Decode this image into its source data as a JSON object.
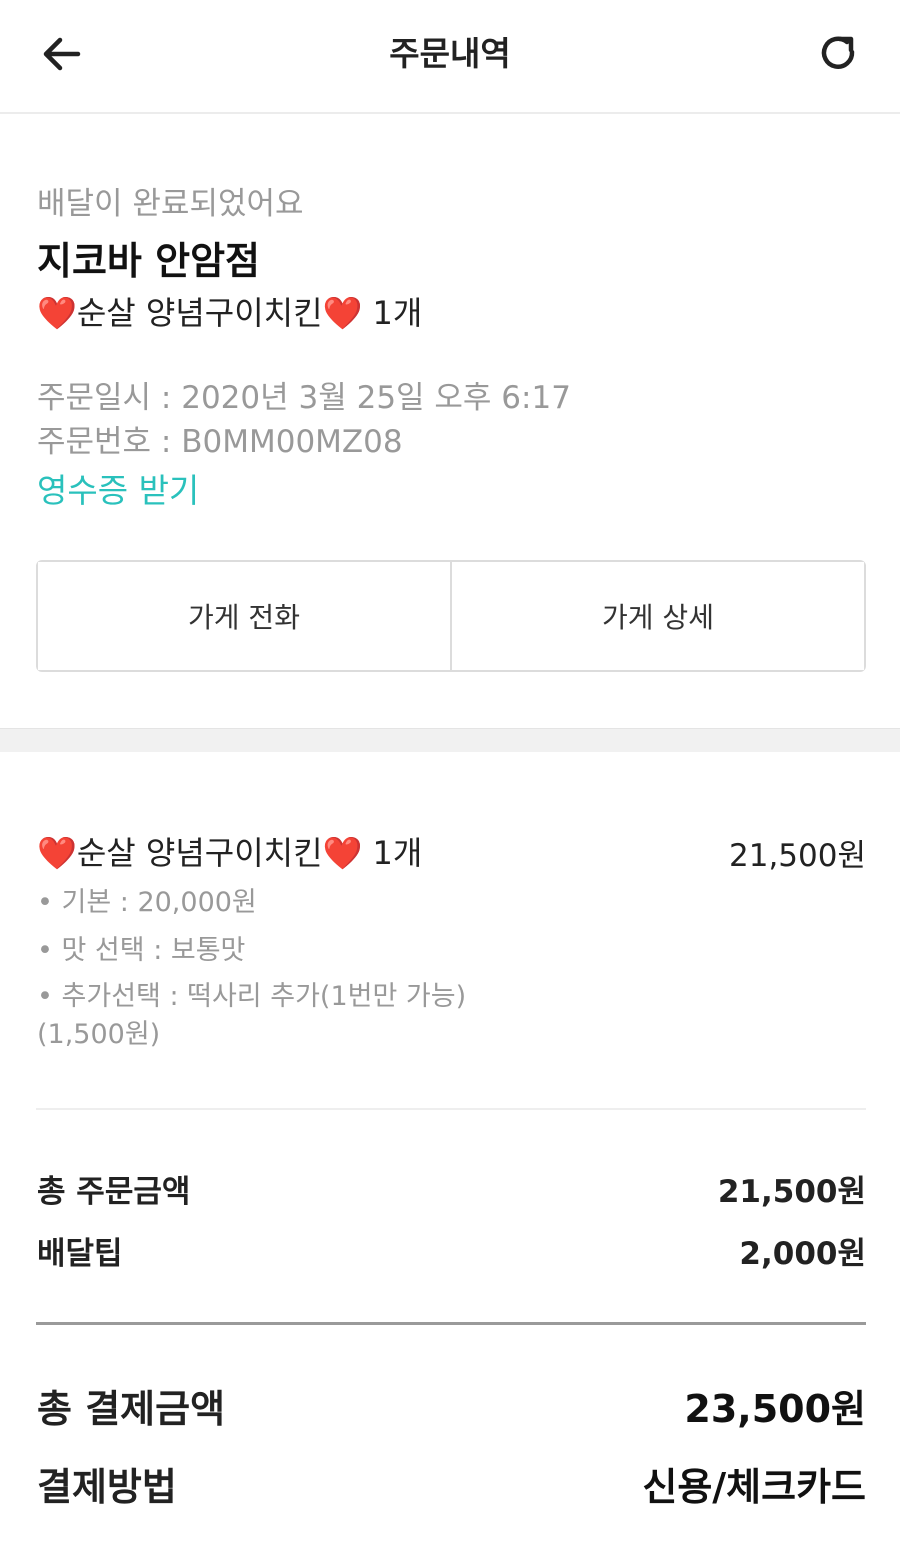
{
  "header": {
    "title": "주문내역",
    "back_icon": "arrow-left-icon",
    "refresh_icon": "refresh-icon"
  },
  "order": {
    "status": "배달이 완료되었어요",
    "store_name": "지코바 안암점",
    "menu_summary": "❤️순살 양념구이치킨❤️ 1개",
    "order_date": "주문일시 : 2020년 3월 25일 오후 6:17",
    "order_number": "주문번호 : B0MM00MZ08",
    "receipt_link": "영수증 받기"
  },
  "actions": {
    "call_store": "가게 전화",
    "store_detail": "가게 상세"
  },
  "item": {
    "name": "❤️순살 양념구이치킨❤️ 1개",
    "price": "21,500원",
    "options": [
      "• 기본 : 20,000원",
      "• 맛 선택 : 보통맛",
      "• 추가선택 : 떡사리 추가(1번만 가능)",
      "(1,500원)"
    ]
  },
  "summary": {
    "total_order_label": "총 주문금액",
    "total_order_value": "21,500원",
    "delivery_tip_label": "배달팁",
    "delivery_tip_value": "2,000원",
    "total_payment_label": "총 결제금액",
    "total_payment_value": "23,500원",
    "payment_method_label": "결제방법",
    "payment_method_value": "신용/체크카드"
  },
  "colors": {
    "accent": "#2ac1bc",
    "heart": "#e0202b",
    "muted_text": "#999999"
  }
}
